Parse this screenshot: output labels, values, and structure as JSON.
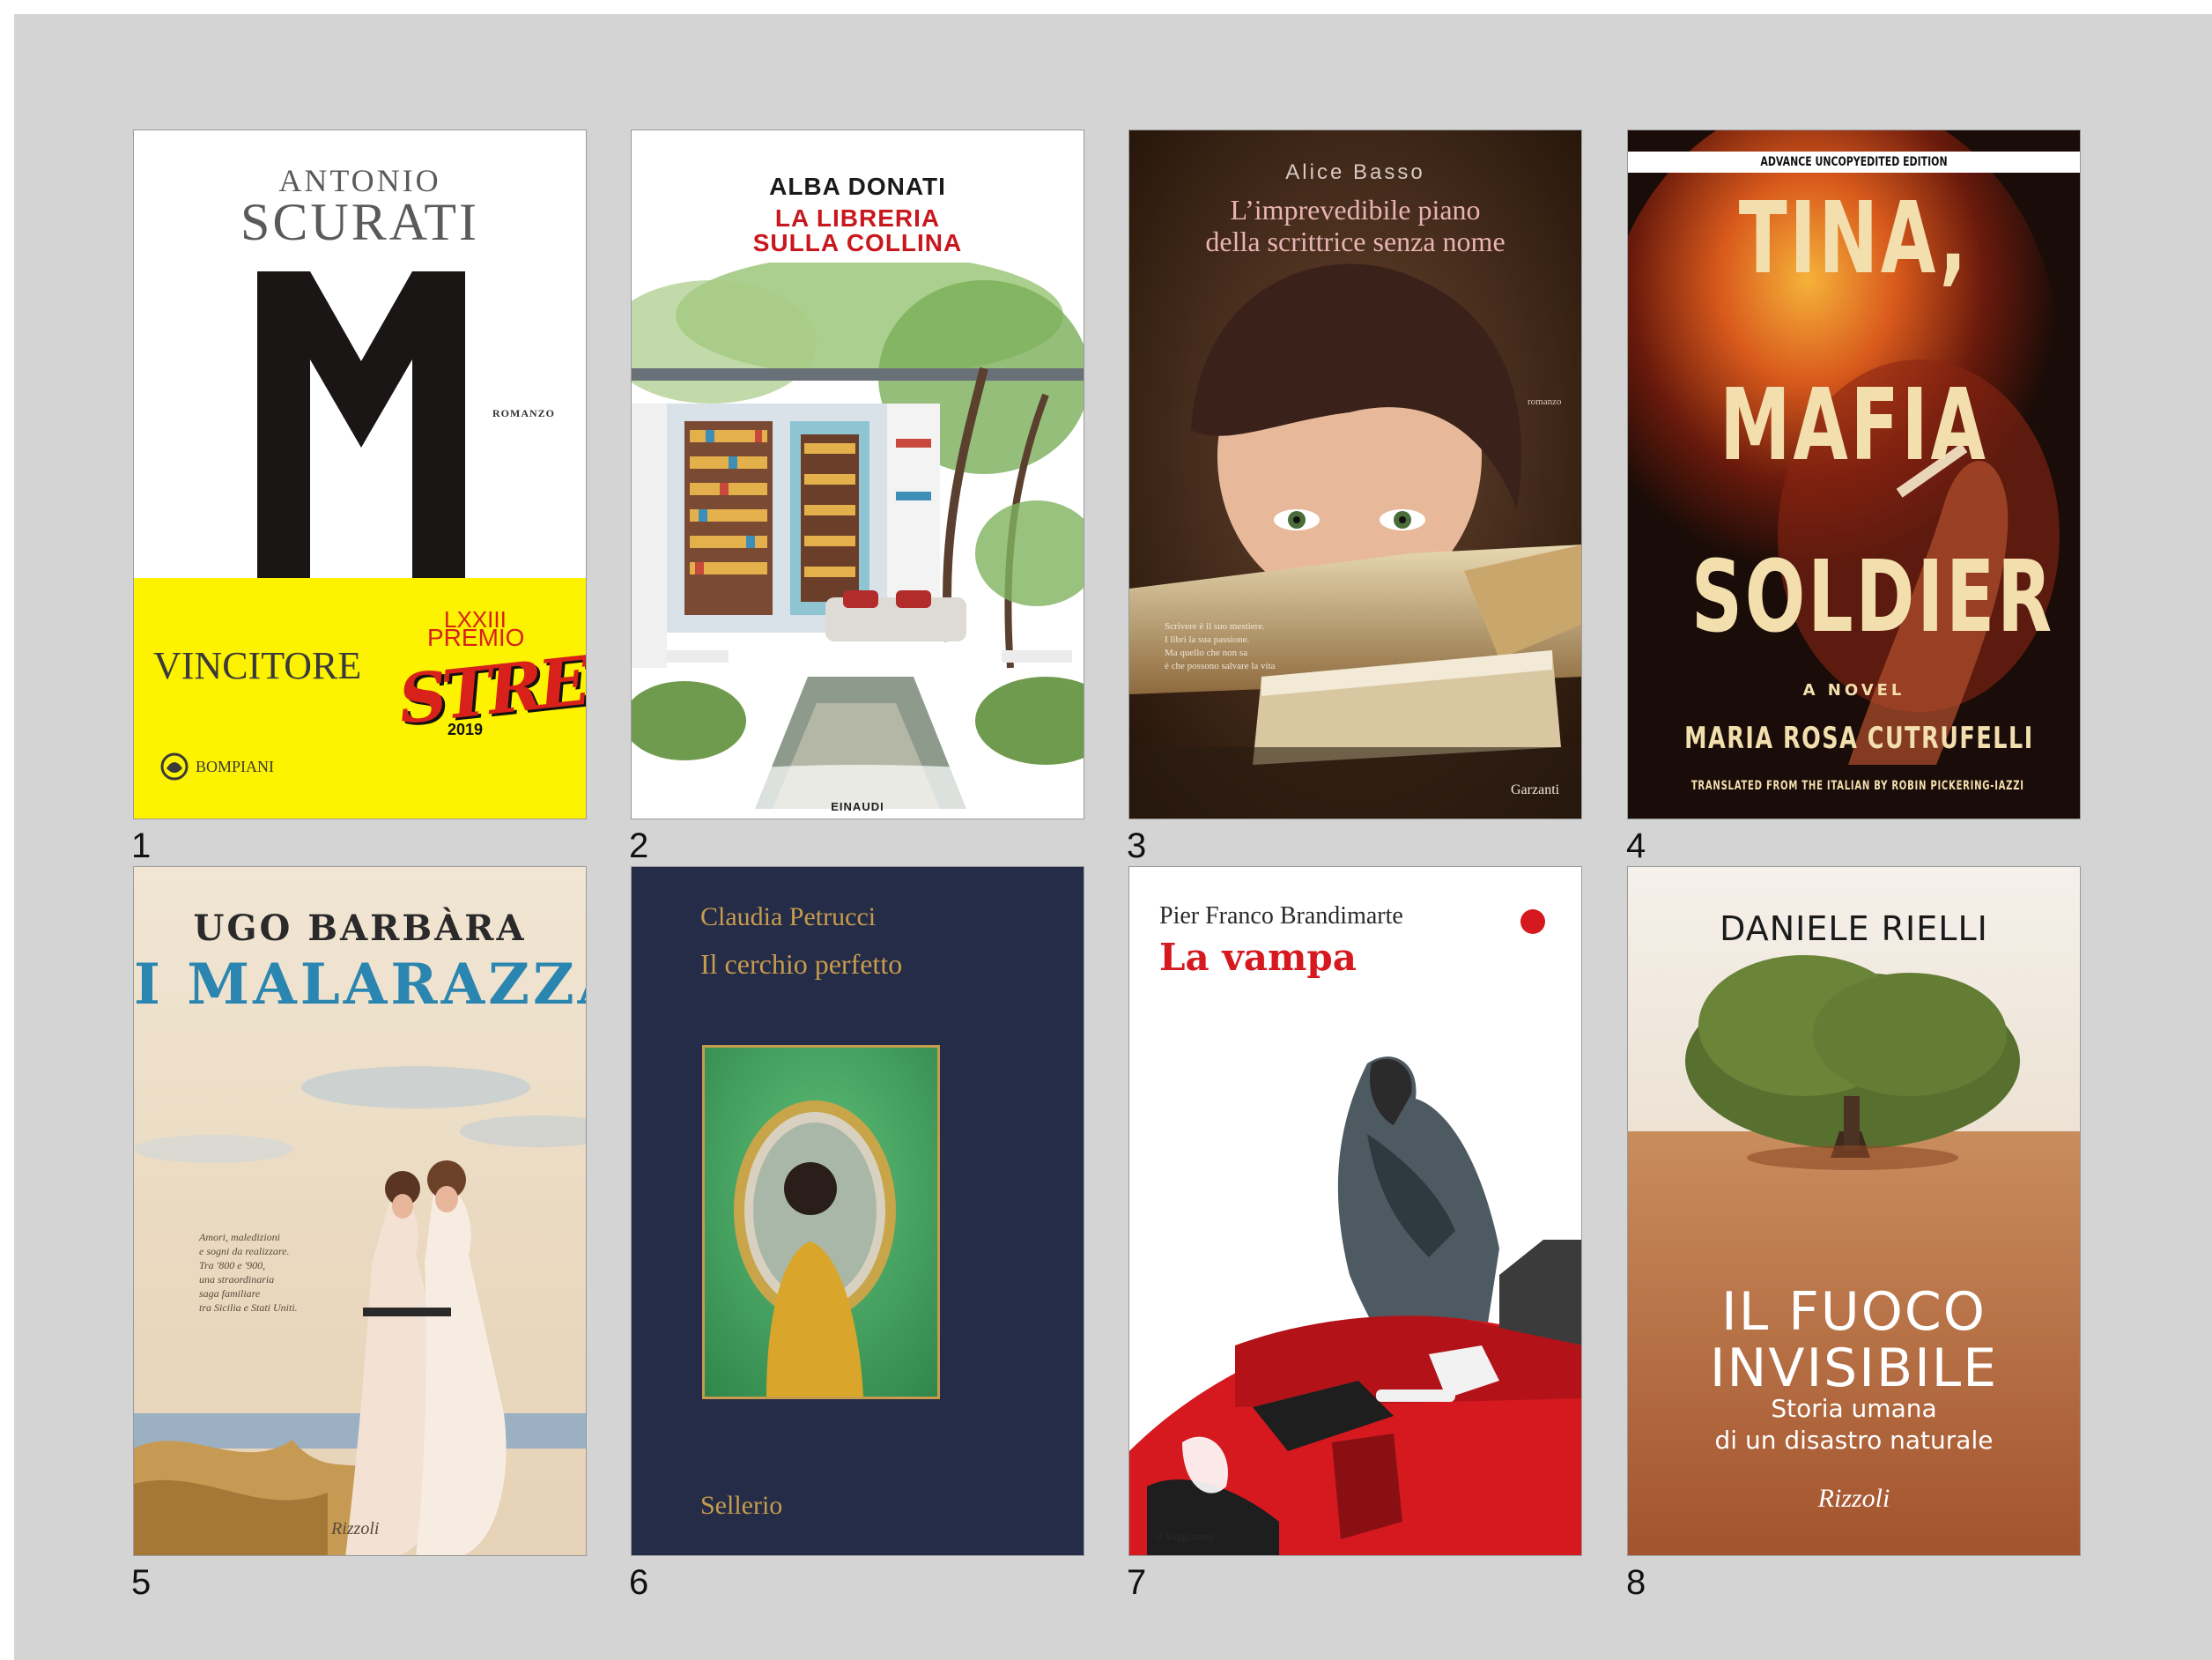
{
  "labels": [
    "1",
    "2",
    "3",
    "4",
    "5",
    "6",
    "7",
    "8"
  ],
  "book1": {
    "author": "ANTONIO SCURATI",
    "author_first": "ANTONIO",
    "author_last": "SCURATI",
    "title_letter": "M",
    "genre": "ROMANZO",
    "winner": "VINCITORE",
    "award_roman": "LXXIII",
    "award_prize": "PREMIO",
    "award_name": "STREGA",
    "award_year": "2019",
    "publisher": "BOMPIANI",
    "colors": {
      "band": "#fdf200",
      "letter": "#1a1616",
      "strega_red": "#d7211a"
    }
  },
  "book2": {
    "author": "ALBA DONATI",
    "title_line1": "LA LIBRERIA",
    "title_line2": "SULLA COLLINA",
    "publisher": "EINAUDI",
    "colors": {
      "title": "#c8171d"
    }
  },
  "book3": {
    "author": "Alice Basso",
    "title_line1": "L’imprevedibile piano",
    "title_line2": "della scrittrice senza nome",
    "genre": "romanzo",
    "blurb": [
      "Scrivere è il suo mestiere.",
      "I libri la sua passione.",
      "Ma quello che non sa",
      "è che possono salvare la vita"
    ],
    "publisher": "Garzanti"
  },
  "book4": {
    "banner": "ADVANCE UNCOPYEDITED EDITION",
    "title_line1": "TINA,",
    "title_line2": "MAFIA",
    "title_line3": "SOLDIER",
    "subtitle": "A NOVEL",
    "author": "MARIA ROSA CUTRUFELLI",
    "translator": "TRANSLATED FROM THE ITALIAN BY ROBIN PICKERING-IAZZI",
    "colors": {
      "title": "#f3dfae"
    }
  },
  "book5": {
    "author": "UGO BARBÀRA",
    "title": "I MALARAZZA",
    "blurb": [
      "Amori, maledizioni",
      "e sogni da realizzare.",
      "Tra '800 e '900,",
      "una straordinaria",
      "saga familiare",
      "tra Sicilia e Stati Uniti."
    ],
    "publisher": "Rizzoli",
    "colors": {
      "title": "#2a86b0"
    }
  },
  "book6": {
    "author": "Claudia Petrucci",
    "title": "Il cerchio perfetto",
    "publisher": "Sellerio",
    "colors": {
      "text": "#c79b4e",
      "bg": "#252c47"
    }
  },
  "book7": {
    "author": "Pier Franco Brandimarte",
    "title": "La vampa",
    "publisher": "il Saggiatore",
    "colors": {
      "title": "#d5191f"
    }
  },
  "book8": {
    "author": "DANIELE RIELLI",
    "title_line1": "IL FUOCO",
    "title_line2": "INVISIBILE",
    "subtitle_line1": "Storia umana",
    "subtitle_line2": "di un disastro naturale",
    "publisher": "Rizzoli"
  }
}
